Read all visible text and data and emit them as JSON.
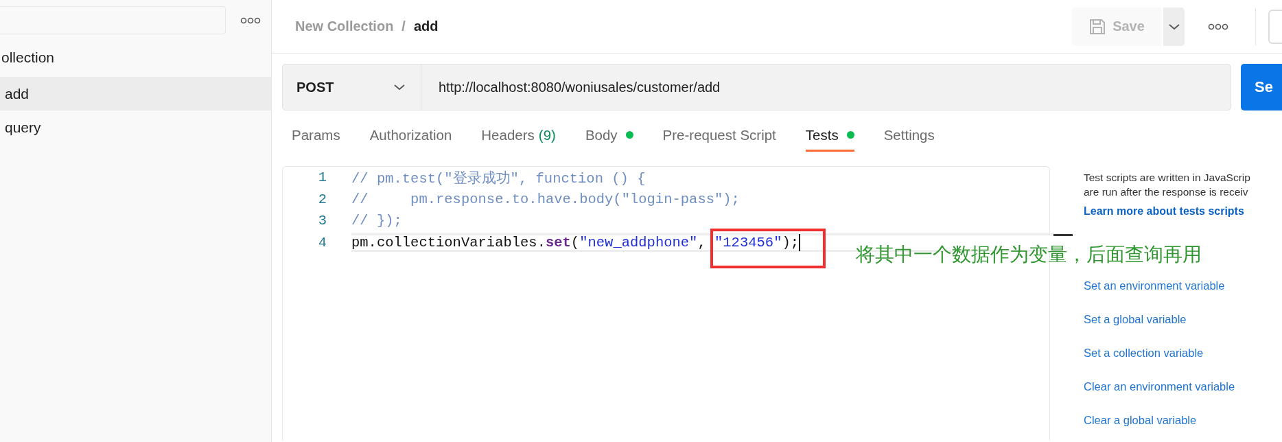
{
  "sidebar": {
    "tree": [
      {
        "label": "ollection",
        "children": [
          {
            "label": "add",
            "selected": true
          },
          {
            "label": "query",
            "selected": false
          }
        ]
      }
    ]
  },
  "header": {
    "breadcrumb": [
      "New Collection",
      "add"
    ],
    "breadcrumb_separator": "/",
    "save_button": {
      "label": "Save",
      "disabled": true
    }
  },
  "request": {
    "method": "POST",
    "url": "http://localhost:8080/woniusales/customer/add",
    "send_button": "Se"
  },
  "tabs": [
    {
      "label": "Params",
      "selected": false,
      "has_content": false
    },
    {
      "label": "Authorization",
      "selected": false,
      "has_content": false
    },
    {
      "label": "Headers",
      "count": "(9)",
      "selected": false,
      "has_content": false
    },
    {
      "label": "Body",
      "selected": false,
      "has_content": true
    },
    {
      "label": "Pre-request Script",
      "selected": false,
      "has_content": false
    },
    {
      "label": "Tests",
      "selected": true,
      "has_content": true
    },
    {
      "label": "Settings",
      "selected": false,
      "has_content": false
    }
  ],
  "editor": {
    "lines": [
      {
        "number": "1",
        "active": false,
        "cursor": false,
        "tokens": [
          {
            "kind": "comment",
            "text": "// pm.test(\"登录成功\", function () {"
          }
        ]
      },
      {
        "number": "2",
        "active": false,
        "cursor": false,
        "tokens": [
          {
            "kind": "comment",
            "text": "//     pm.response.to.have.body(\"login-pass\");"
          }
        ]
      },
      {
        "number": "3",
        "active": false,
        "cursor": false,
        "tokens": [
          {
            "kind": "comment",
            "text": "// });"
          }
        ]
      },
      {
        "number": "4",
        "active": true,
        "cursor": true,
        "tokens": [
          {
            "kind": "plain",
            "text": "pm.collectionVariables."
          },
          {
            "kind": "keyword",
            "text": "set"
          },
          {
            "kind": "plain",
            "text": "("
          },
          {
            "kind": "string",
            "text": "\"new_addphone\""
          },
          {
            "kind": "plain",
            "text": ", "
          },
          {
            "kind": "string",
            "text": "\"123456\""
          },
          {
            "kind": "plain",
            "text": ");"
          }
        ]
      }
    ]
  },
  "snippets": {
    "description": [
      "Test scripts are written in JavaScrip",
      "are run after the response is receiv"
    ],
    "learn_more": "Learn more about tests scripts",
    "links": [
      "Set an environment variable",
      "Set a global variable",
      "Set a collection variable",
      "Clear an environment variable",
      "Clear a global variable"
    ]
  },
  "annotation": {
    "text": "将其中一个数据作为变量，后面查询再用"
  }
}
